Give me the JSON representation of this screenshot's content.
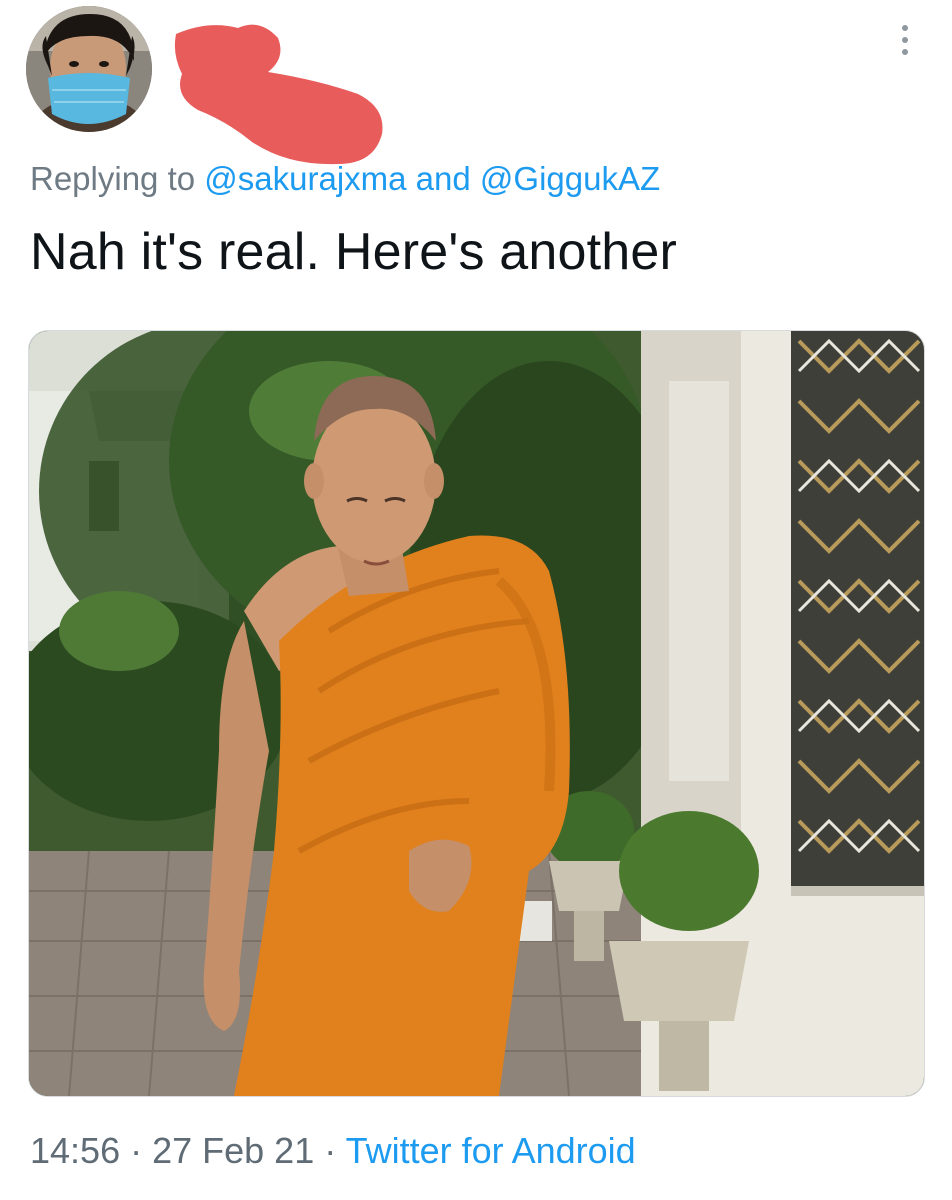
{
  "tweet": {
    "reply_prefix": "Replying to ",
    "reply_mention_1": "@sakurajxma",
    "reply_joiner": " and ",
    "reply_mention_2": "@GiggukAZ",
    "text": "Nah it's real. Here's another",
    "time": "14:56",
    "separator": " · ",
    "date": "27 Feb 21",
    "source": "Twitter for Android"
  },
  "icons": {
    "more": "more-vertical-icon",
    "avatar": "user-avatar"
  },
  "colors": {
    "link": "#1d9bf0",
    "secondary_text": "#6e7a84",
    "primary_text": "#0f1419",
    "redaction": "#e95c5c",
    "robe": "#e0811d"
  }
}
